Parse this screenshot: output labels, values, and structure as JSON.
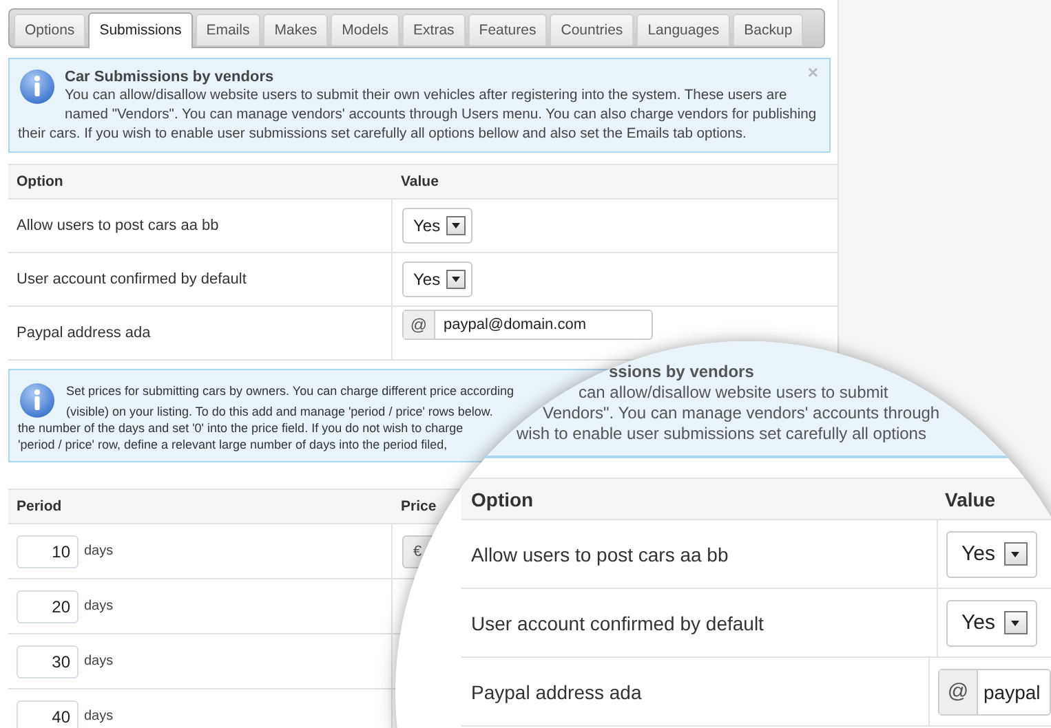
{
  "tabs": [
    {
      "label": "Options",
      "selected": false
    },
    {
      "label": "Submissions",
      "selected": true
    },
    {
      "label": "Emails",
      "selected": false
    },
    {
      "label": "Makes",
      "selected": false
    },
    {
      "label": "Models",
      "selected": false
    },
    {
      "label": "Extras",
      "selected": false
    },
    {
      "label": "Features",
      "selected": false
    },
    {
      "label": "Countries",
      "selected": false
    },
    {
      "label": "Languages",
      "selected": false
    },
    {
      "label": "Backup",
      "selected": false
    }
  ],
  "info": {
    "title": "Car Submissions by vendors",
    "text": "You can allow/disallow website users to submit their own vehicles after registering into the system. These users are named \"Vendors\". You can manage vendors' accounts through Users menu. You can also charge vendors for publishing their cars. If you wish to enable user submissions set carefully all options bellow and also set the Emails tab options.",
    "dismiss": "×"
  },
  "settings_table": {
    "columns": [
      "Option",
      "Value"
    ],
    "rows": [
      {
        "kind": "select",
        "label": "Allow users to post cars aa bb",
        "value": "Yes"
      },
      {
        "kind": "select",
        "label": "User account confirmed by default",
        "value": "Yes"
      },
      {
        "kind": "addon_input",
        "label": "Paypal address ada",
        "addon": "@",
        "value": "paypal@domain.com"
      }
    ]
  },
  "pricing_info": {
    "lines": [
      "Set prices for submitting cars by owners. You can charge different price according",
      "(visible) on your listing. To do this add and manage 'period / price' rows below.",
      "the number of the days and set '0' into the price field. If you do not wish to charge",
      "'period / price' row, define a relevant large number of days into the period filed,"
    ]
  },
  "pricing_table": {
    "columns": [
      "Period",
      "Price"
    ],
    "rows": [
      {
        "period": "10",
        "unit": "days",
        "addon": "€"
      },
      {
        "period": "20",
        "unit": "days"
      },
      {
        "period": "30",
        "unit": "days"
      },
      {
        "period": "40",
        "unit": "days"
      }
    ]
  },
  "magnifier": {
    "info_lines": [
      "ssions by vendors",
      "can allow/disallow website users to submit",
      "Vendors\". You can manage vendors' accounts through",
      "wish to enable user submissions set carefully all options"
    ],
    "columns": [
      "Option",
      "Value"
    ],
    "rows": [
      {
        "kind": "select",
        "label": "Allow users to post cars aa bb",
        "value": "Yes"
      },
      {
        "kind": "select",
        "label": "User account confirmed by default",
        "value": "Yes"
      },
      {
        "kind": "addon_input",
        "label": "Paypal address ada",
        "addon": "@",
        "value": "paypal"
      }
    ]
  }
}
